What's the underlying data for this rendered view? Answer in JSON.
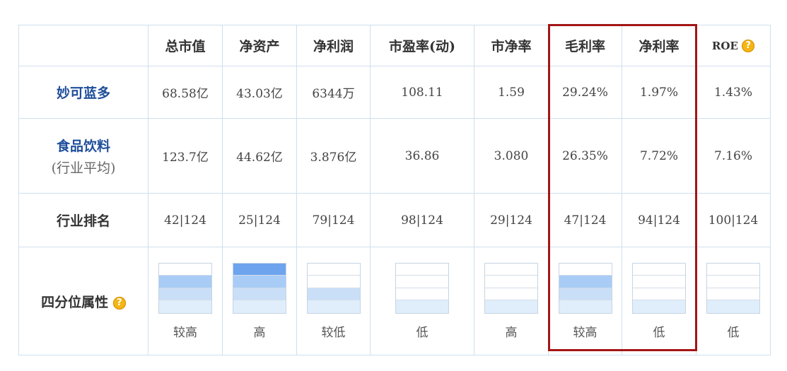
{
  "headers": [
    "",
    "总市值",
    "净资产",
    "净利润",
    "市盈率(动)",
    "市净率",
    "毛利率",
    "净利率",
    "ROE"
  ],
  "rows": {
    "company": {
      "label": "妙可蓝多",
      "values": [
        "68.58亿",
        "43.03亿",
        "6344万",
        "108.11",
        "1.59",
        "29.24%",
        "1.97%",
        "1.43%"
      ]
    },
    "industry": {
      "label": "食品饮料",
      "sublabel": "(行业平均)",
      "values": [
        "123.7亿",
        "44.62亿",
        "3.876亿",
        "36.86",
        "3.080",
        "26.35%",
        "7.72%",
        "7.16%"
      ]
    },
    "rank": {
      "label": "行业排名",
      "values": [
        "42|124",
        "25|124",
        "79|124",
        "98|124",
        "29|124",
        "47|124",
        "94|124",
        "100|124"
      ]
    },
    "quartile": {
      "label": "四分位属性",
      "items": [
        {
          "label": "较高",
          "level": 3
        },
        {
          "label": "高",
          "level": 4
        },
        {
          "label": "较低",
          "level": 2
        },
        {
          "label": "低",
          "level": 1
        },
        {
          "label": "高",
          "level": 1
        },
        {
          "label": "较高",
          "level": 3
        },
        {
          "label": "低",
          "level": 1
        },
        {
          "label": "低",
          "level": 1
        }
      ]
    }
  },
  "help_icon_glyph": "?",
  "icons": {
    "help": "question-circle-icon"
  },
  "colors": {
    "company_label": "#1e4e9a",
    "highlight_border": "#a31515",
    "help_icon": "#f5b515",
    "bar_level_4": "#6ea4ee",
    "bar_level_3": "#a8ccf6",
    "bar_level_2": "#c9dff8",
    "bar_level_1": "#e0edfb"
  }
}
